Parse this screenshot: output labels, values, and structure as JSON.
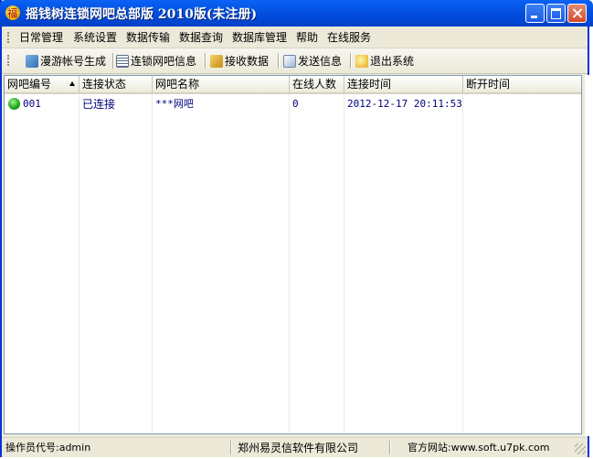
{
  "window": {
    "title": "摇钱树连锁网吧总部版  2010版(未注册)"
  },
  "menu": {
    "items": [
      "日常管理",
      "系统设置",
      "数据传输",
      "数据查询",
      "数据库管理",
      "帮助",
      "在线服务"
    ]
  },
  "toolbar": {
    "buttons": [
      {
        "label": "漫游帐号生成",
        "icon": "user-card-icon"
      },
      {
        "label": "连锁网吧信息",
        "icon": "list-icon"
      },
      {
        "label": "接收数据",
        "icon": "receive-icon"
      },
      {
        "label": "发送信息",
        "icon": "send-icon"
      },
      {
        "label": "退出系统",
        "icon": "exit-icon"
      }
    ]
  },
  "table": {
    "columns": [
      "网吧编号",
      "连接状态",
      "网吧名称",
      "在线人数",
      "连接时间",
      "断开时间"
    ],
    "sort_column": "网吧编号",
    "rows": [
      {
        "id": "001",
        "status": "已连接",
        "name": "***网吧",
        "online": "0",
        "connect_time": "2012-12-17 20:11:53",
        "disconnect_time": ""
      }
    ]
  },
  "statusbar": {
    "operator": "操作员代号:admin",
    "company": "郑州易灵信软件有限公司",
    "website": "官方网站:www.soft.u7pk.com"
  },
  "colors": {
    "titlebar": "#0453e3",
    "status_connected": "#19a317",
    "cell_text": "#00007f"
  }
}
